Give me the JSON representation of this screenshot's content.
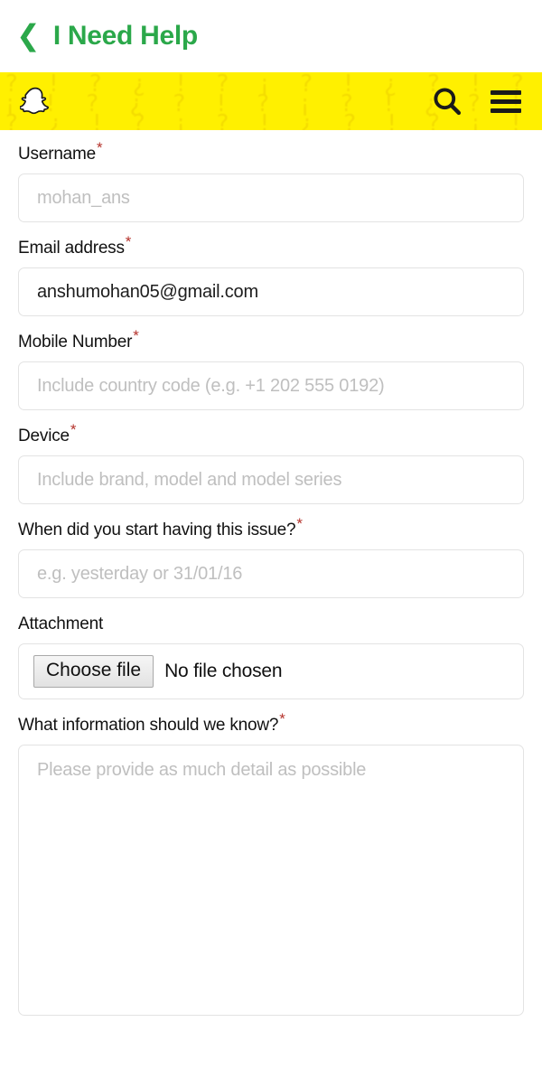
{
  "header": {
    "back_icon": "chevron-left-icon",
    "title": "I Need Help",
    "title_color": "#2ba84a"
  },
  "snapbar": {
    "background_color": "#fff000",
    "logo_icon": "snapchat-ghost-icon",
    "search_icon": "search-icon",
    "menu_icon": "hamburger-menu-icon",
    "pattern_text": "? ! ? ¿ ! ? ¡ ? ! ¿ ? ! ? ¡ ! ? ¿ ? ! ? ¡ ? ! ¿ ? ! ? ¿ ! ? ¡ ? ! ¿ ? ! ? ¡ ! ? ¿ ? ! ? ¡ ? ! ¿ ? !"
  },
  "form": {
    "required_marker": "*",
    "required_marker_color": "#b5332c",
    "fields": [
      {
        "label": "Username",
        "required": true,
        "value": "",
        "placeholder": "mohan_ans"
      },
      {
        "label": "Email address",
        "required": true,
        "value": "anshumohan05@gmail.com",
        "placeholder": ""
      },
      {
        "label": "Mobile Number",
        "required": true,
        "value": "",
        "placeholder": "Include country code (e.g. +1 202 555 0192)"
      },
      {
        "label": "Device",
        "required": true,
        "value": "",
        "placeholder": "Include brand, model and model series"
      },
      {
        "label": "When did you start having this issue?",
        "required": true,
        "value": "",
        "placeholder": "e.g. yesterday or 31/01/16"
      }
    ],
    "attachment": {
      "label": "Attachment",
      "required": false,
      "button_label": "Choose file",
      "status_text": "No file chosen"
    },
    "details": {
      "label": "What information should we know?",
      "required": true,
      "value": "",
      "placeholder": "Please provide as much detail as possible"
    }
  }
}
